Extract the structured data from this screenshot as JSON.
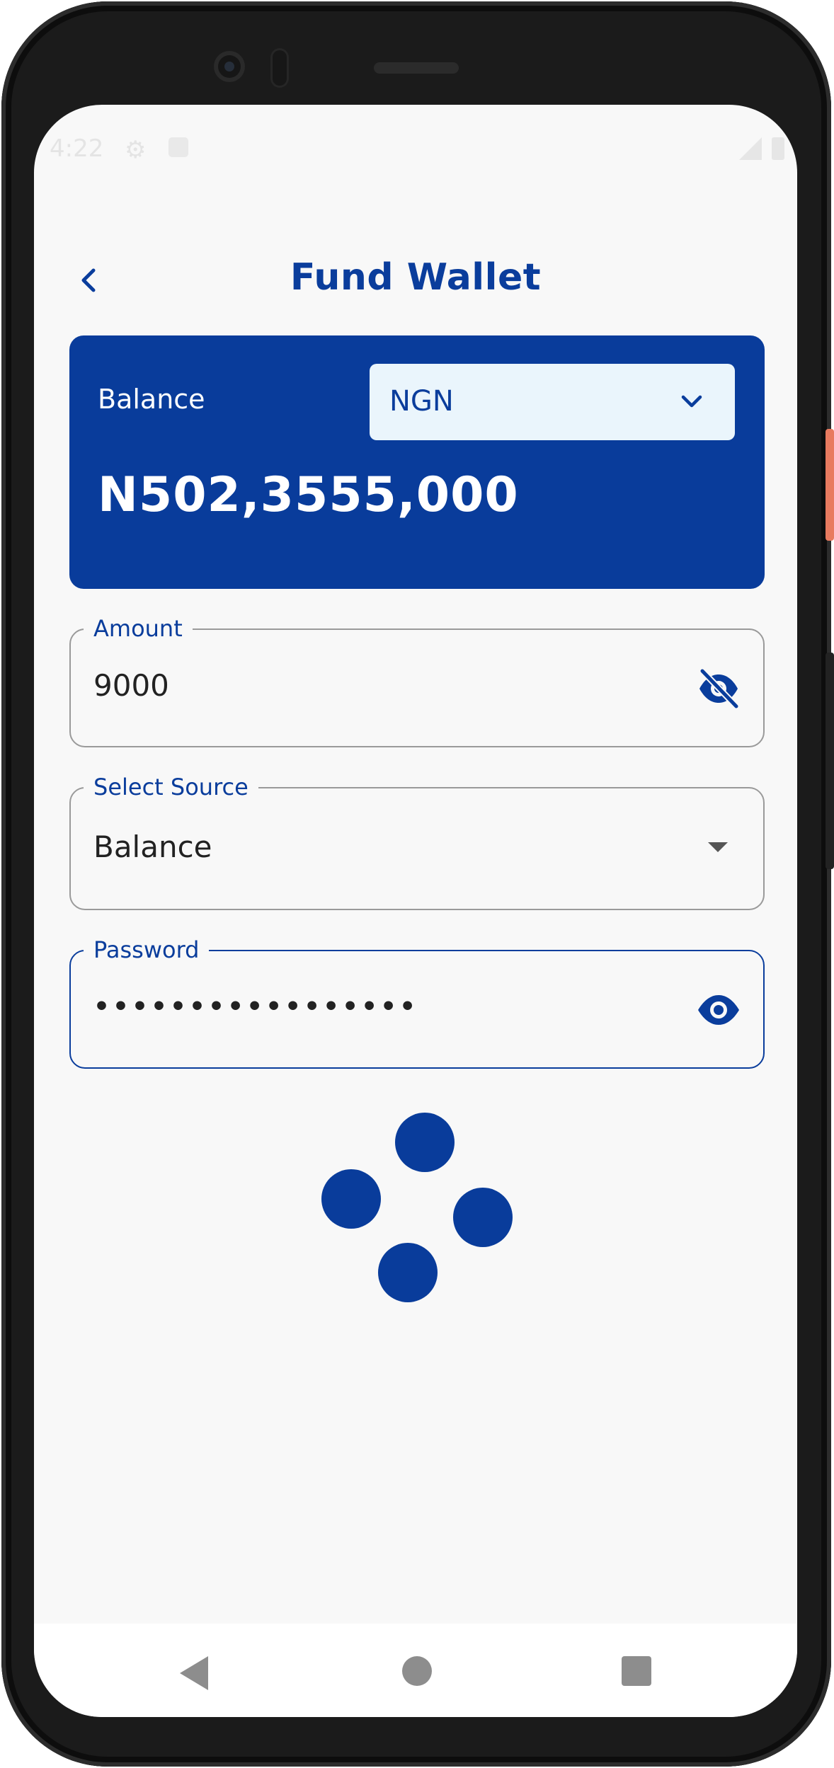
{
  "status_bar": {
    "time": "4:22"
  },
  "header": {
    "title": "Fund Wallet"
  },
  "balance_card": {
    "label": "Balance",
    "currency": "NGN",
    "amount": "N502,3555,000"
  },
  "amount_field": {
    "label": "Amount",
    "value": "9000"
  },
  "source_field": {
    "label": "Select Source",
    "value": "Balance"
  },
  "password_field": {
    "label": "Password",
    "value": "•••••••••••••••••"
  },
  "colors": {
    "brand": "#093c9b",
    "card_select_bg": "#eaf5fc",
    "screen_bg": "#f8f8f8"
  },
  "icons": {
    "back": "chevron-left-icon",
    "currency_dropdown": "chevron-down-icon",
    "amount_visibility": "eye-off-icon",
    "source_dropdown": "caret-down-icon",
    "password_visibility": "eye-icon",
    "loading": "loading-dots-icon"
  }
}
